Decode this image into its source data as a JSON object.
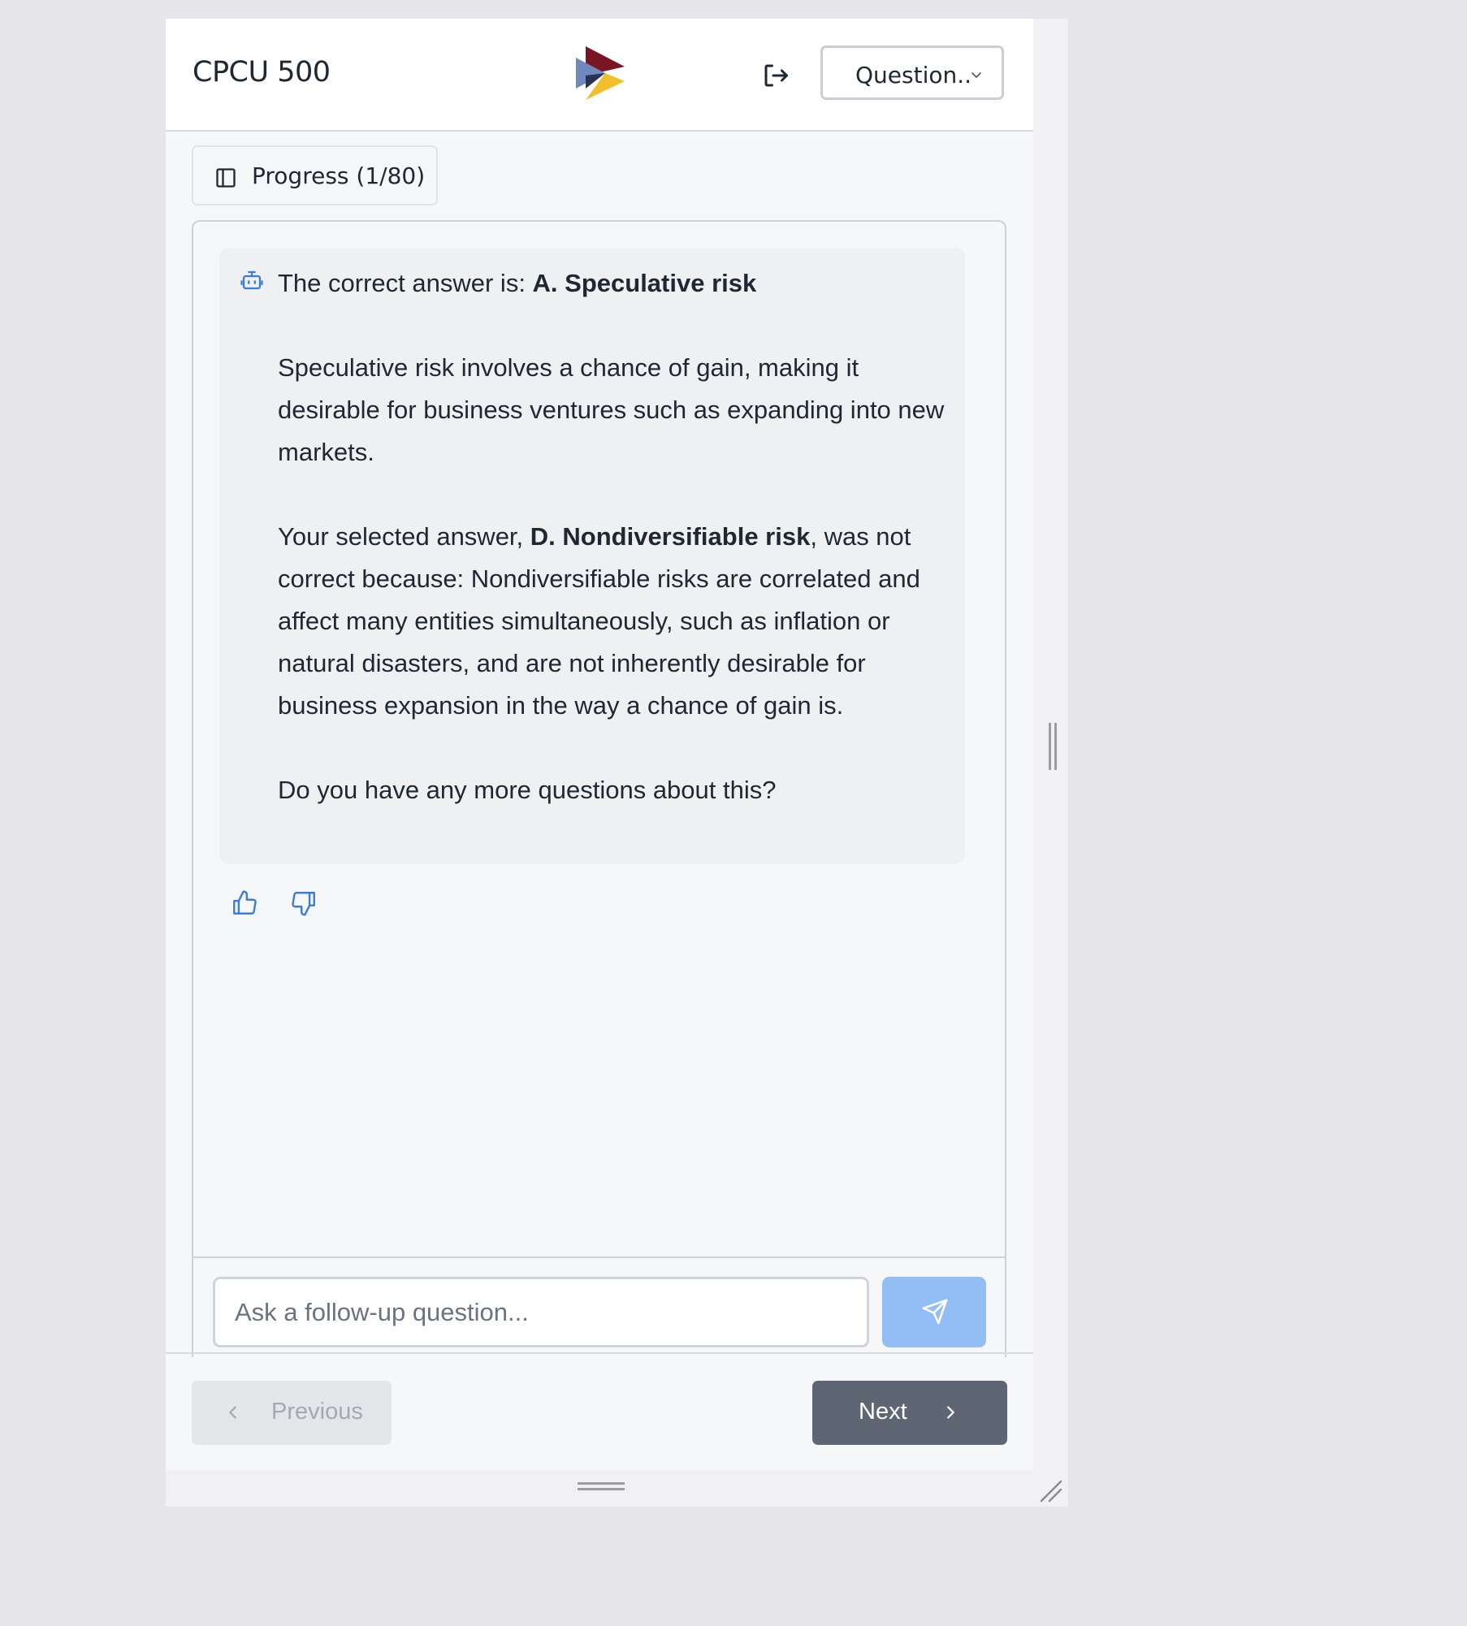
{
  "header": {
    "title": "CPCU 500",
    "logout_icon": "logout-icon",
    "question_dropdown": "Question.."
  },
  "progress": {
    "label": "Progress (1/80)",
    "current": 1,
    "total": 80,
    "icon": "sidebar-panel-icon"
  },
  "message": {
    "icon": "robot-icon",
    "line1_prefix": "The correct answer is: ",
    "line1_bold": "A. Speculative risk",
    "para2": "Speculative risk involves a chance of gain, making it desirable for business ventures such as expanding into new markets.",
    "para3_prefix": "Your selected answer, ",
    "para3_bold": "D. Nondiversifiable risk",
    "para3_suffix": ", was not correct because: Nondiversifiable risks are correlated and affect many entities simultaneously, such as inflation or natural disasters, and are not inherently desirable for business expansion in the way a chance of gain is.",
    "para4": "Do you have any more questions about this?"
  },
  "feedback": {
    "thumbs_up_icon": "thumbs-up-icon",
    "thumbs_down_icon": "thumbs-down-icon"
  },
  "followup": {
    "placeholder": "Ask a follow-up question...",
    "value": "",
    "send_icon": "send-icon"
  },
  "nav": {
    "previous_label": "Previous",
    "next_label": "Next"
  },
  "colors": {
    "accent": "#3b7dd8",
    "send_button": "#93bdf5",
    "next_button": "#5f6673",
    "logo_dark_red": "#7a1624",
    "logo_blue": "#7088bd",
    "logo_yellow": "#f0c02c"
  }
}
